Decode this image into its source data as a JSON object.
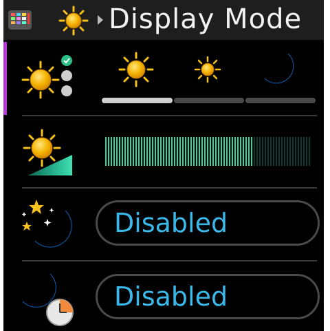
{
  "header": {
    "title": "Display Mode",
    "app_icon": "grid-app-icon",
    "sun_icon": "sun-icon",
    "arrow_icon": "triangle-right-icon"
  },
  "display_mode": {
    "icon": "sun-with-radio-options-icon",
    "options": [
      {
        "icon": "sun-large-icon",
        "selected": true
      },
      {
        "icon": "sun-small-icon",
        "selected": false
      },
      {
        "icon": "moon-icon",
        "selected": false
      }
    ]
  },
  "brightness": {
    "icon": "sun-brightness-ramp-icon",
    "level": 0.72
  },
  "night_mode": {
    "icon": "moon-stars-icon",
    "value": "Disabled"
  },
  "night_schedule": {
    "icon": "moon-clock-icon",
    "value": "Disabled"
  },
  "colors": {
    "accent": "#b53ad8",
    "value_text": "#3ab8ea",
    "bar_fill": "#2fd3a3",
    "header_bg": "#1e1e1e"
  }
}
